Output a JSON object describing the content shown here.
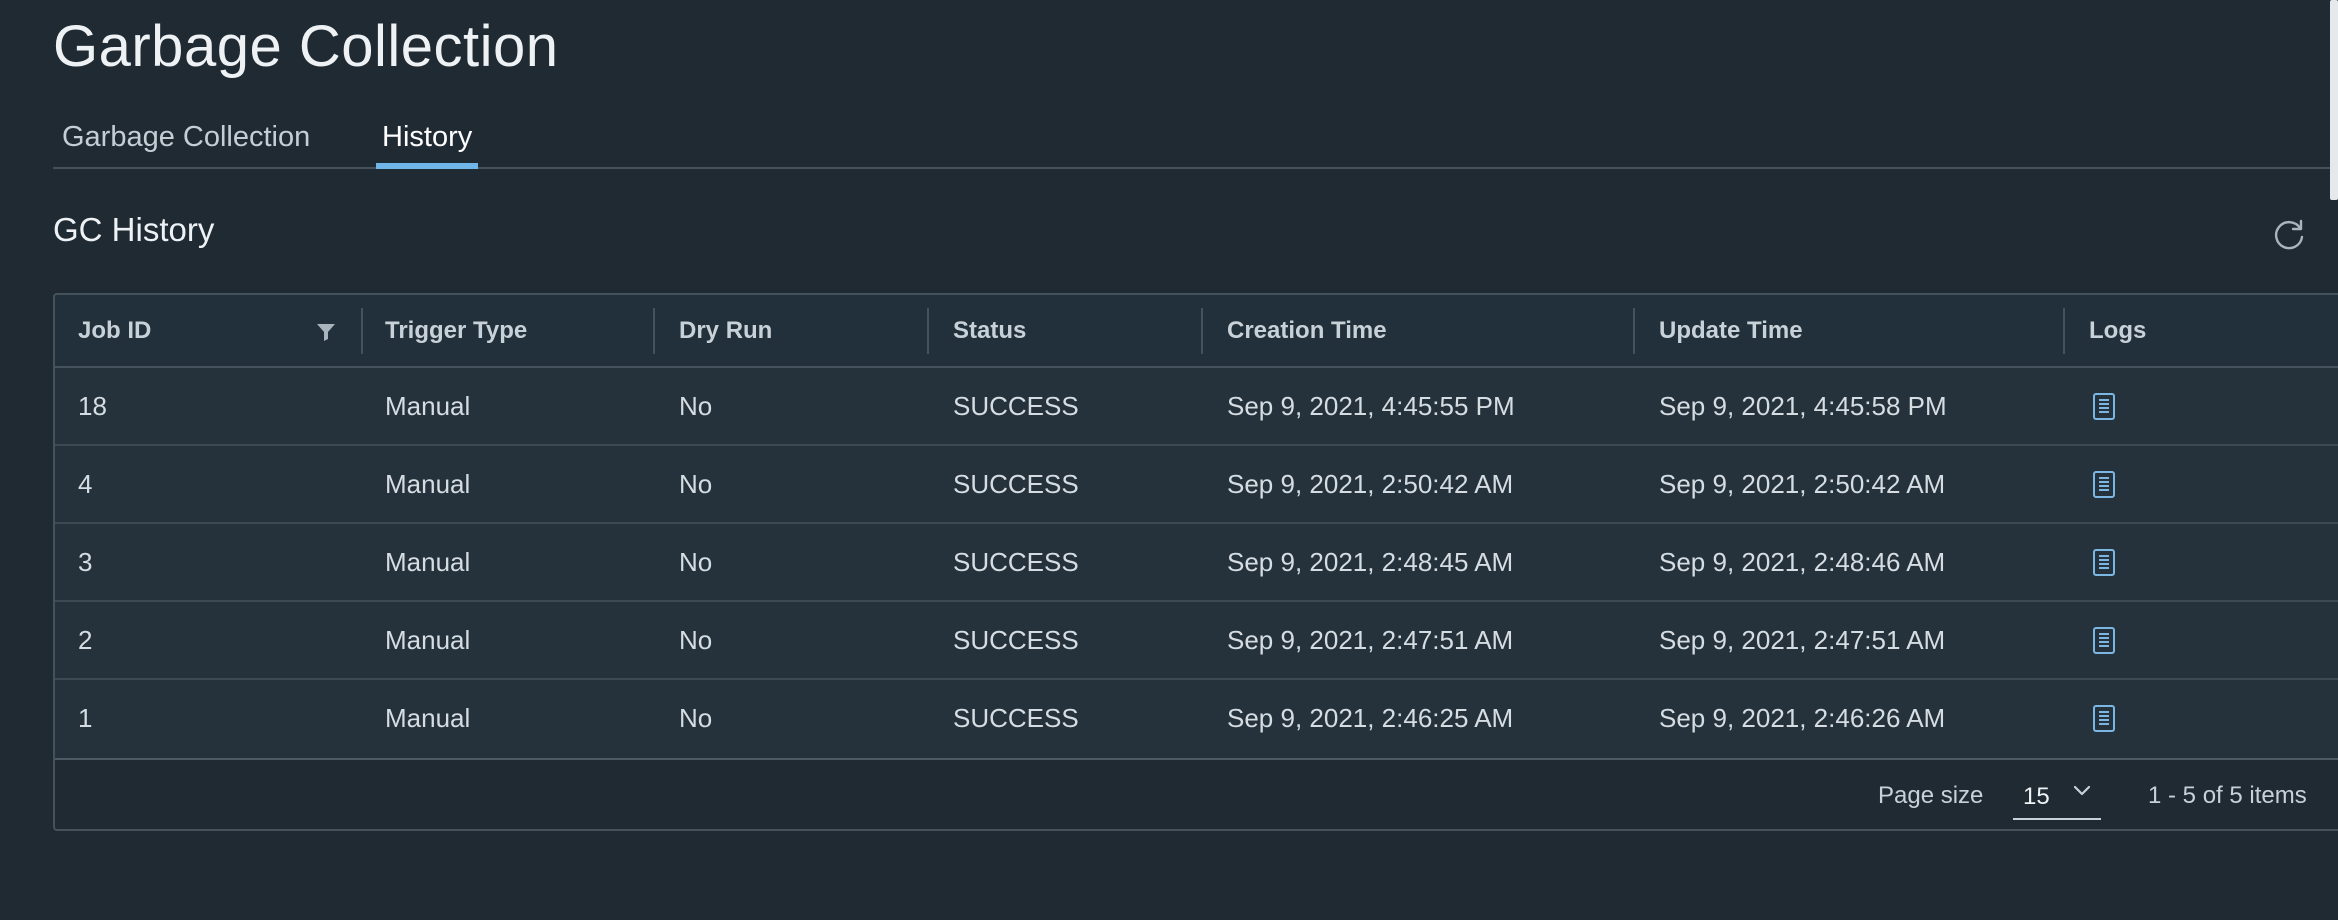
{
  "page": {
    "title": "Garbage Collection"
  },
  "tabs": [
    {
      "label": "Garbage Collection",
      "active": false
    },
    {
      "label": "History",
      "active": true
    }
  ],
  "section": {
    "title": "GC History"
  },
  "table": {
    "columns": [
      "Job ID",
      "Trigger Type",
      "Dry Run",
      "Status",
      "Creation Time",
      "Update Time",
      "Logs"
    ],
    "rows": [
      {
        "job_id": "18",
        "trigger_type": "Manual",
        "dry_run": "No",
        "status": "SUCCESS",
        "creation_time": "Sep 9, 2021, 4:45:55 PM",
        "update_time": "Sep 9, 2021, 4:45:58 PM",
        "logs_icon": "document-icon"
      },
      {
        "job_id": "4",
        "trigger_type": "Manual",
        "dry_run": "No",
        "status": "SUCCESS",
        "creation_time": "Sep 9, 2021, 2:50:42 AM",
        "update_time": "Sep 9, 2021, 2:50:42 AM",
        "logs_icon": "document-icon"
      },
      {
        "job_id": "3",
        "trigger_type": "Manual",
        "dry_run": "No",
        "status": "SUCCESS",
        "creation_time": "Sep 9, 2021, 2:48:45 AM",
        "update_time": "Sep 9, 2021, 2:48:46 AM",
        "logs_icon": "document-icon"
      },
      {
        "job_id": "2",
        "trigger_type": "Manual",
        "dry_run": "No",
        "status": "SUCCESS",
        "creation_time": "Sep 9, 2021, 2:47:51 AM",
        "update_time": "Sep 9, 2021, 2:47:51 AM",
        "logs_icon": "document-icon"
      },
      {
        "job_id": "1",
        "trigger_type": "Manual",
        "dry_run": "No",
        "status": "SUCCESS",
        "creation_time": "Sep 9, 2021, 2:46:25 AM",
        "update_time": "Sep 9, 2021, 2:46:26 AM",
        "logs_icon": "document-icon"
      }
    ]
  },
  "footer": {
    "page_size_label": "Page size",
    "page_size_value": "15",
    "items_count": "1 - 5 of 5 items"
  },
  "icons": {
    "refresh": "refresh-icon",
    "filter": "filter-icon",
    "logs": "document-icon",
    "dropdown": "chevron-down-icon"
  },
  "colors": {
    "background": "#1f2a33",
    "accent": "#6fb5e8",
    "row_background": "#25323b",
    "border": "#45525c",
    "log_icon": "#7cb6e3"
  }
}
